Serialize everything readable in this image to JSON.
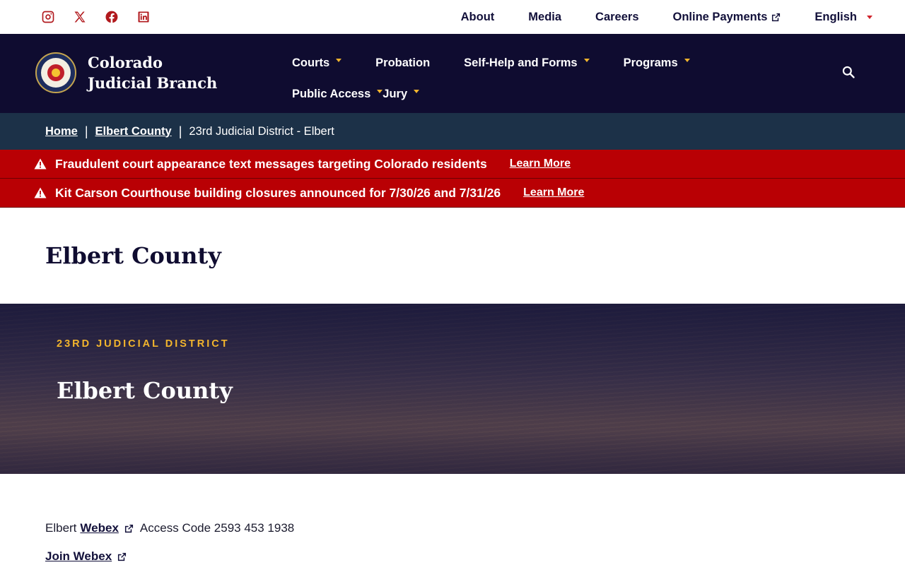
{
  "utility": {
    "social": [
      "instagram-icon",
      "x-icon",
      "facebook-icon",
      "linkedin-icon"
    ],
    "links": [
      {
        "label": "About"
      },
      {
        "label": "Media"
      },
      {
        "label": "Careers"
      },
      {
        "label": "Online Payments",
        "external": true
      }
    ],
    "language": "English"
  },
  "header": {
    "brand": "Colorado Judicial Branch",
    "nav": [
      {
        "label": "Courts",
        "has_menu": true
      },
      {
        "label": "Probation",
        "has_menu": false
      },
      {
        "label": "Self-Help and Forms",
        "has_menu": true
      },
      {
        "label": "Programs",
        "has_menu": true
      },
      {
        "label": "Public Access",
        "has_menu": true
      },
      {
        "label": "Jury",
        "has_menu": true
      }
    ]
  },
  "breadcrumb": {
    "home": "Home",
    "county": "Elbert County",
    "current": "23rd Judicial District - Elbert"
  },
  "alerts": [
    {
      "message": "Fraudulent court appearance text messages targeting Colorado residents",
      "link": "Learn More"
    },
    {
      "message": "Kit Carson Courthouse building closures announced for 7/30/26 and 7/31/26",
      "link": "Learn More"
    }
  ],
  "page_title": "Elbert County",
  "hero": {
    "eyebrow": "23RD JUDICIAL DISTRICT",
    "title": "Elbert County"
  },
  "content": {
    "line1_prefix": "Elbert",
    "line1_link": "Webex",
    "line1_suffix": "Access Code 2593 453 1938",
    "line2_link": "Join Webex"
  },
  "colors": {
    "navy": "#0f0c30",
    "breadcrumb": "#1c3148",
    "alert_red": "#b90004",
    "gold": "#f2b52d",
    "social_red": "#b1191d"
  }
}
